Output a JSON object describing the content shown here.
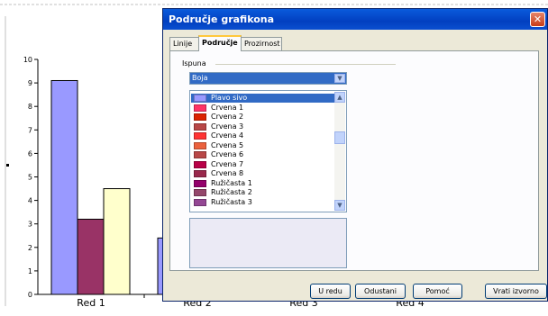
{
  "chart_data": {
    "type": "bar",
    "categories": [
      "Red 1",
      "Red 2",
      "Red 3",
      "Red 4"
    ],
    "series": [
      {
        "values": [
          9.1,
          2.4,
          null,
          null
        ],
        "color": "#9999ff"
      },
      {
        "values": [
          3.2,
          null,
          null,
          null
        ],
        "color": "#993366"
      },
      {
        "values": [
          4.5,
          null,
          null,
          null
        ],
        "color": "#ffffcc"
      }
    ],
    "ylim": [
      0,
      10
    ],
    "yticks": [
      "0",
      "1",
      "2",
      "3",
      "4",
      "5",
      "6",
      "7",
      "8",
      "9",
      "10"
    ]
  },
  "dialog": {
    "title": "Područje grafikona",
    "close_glyph": "✕",
    "tabs": [
      {
        "label": "Linije",
        "active": false
      },
      {
        "label": "Područje",
        "active": true
      },
      {
        "label": "Prozirnost",
        "active": false
      }
    ],
    "fill_group_label": "Ispuna",
    "fill_type": "Boja",
    "colors": [
      {
        "name": "Plavo sivo",
        "color": "#9999ff",
        "selected": true
      },
      {
        "name": "Crvena 1",
        "color": "#ff3366"
      },
      {
        "name": "Crvena 2",
        "color": "#dc2300"
      },
      {
        "name": "Crvena 3",
        "color": "#b84747"
      },
      {
        "name": "Crvena 4",
        "color": "#ff3333"
      },
      {
        "name": "Crvena 5",
        "color": "#eb613d"
      },
      {
        "name": "Crvena 6",
        "color": "#b84747"
      },
      {
        "name": "Crvena 7",
        "color": "#b80047"
      },
      {
        "name": "Crvena 8",
        "color": "#99284c"
      },
      {
        "name": "Ružičasta 1",
        "color": "#94006b"
      },
      {
        "name": "Ružičasta 2",
        "color": "#94476b"
      },
      {
        "name": "Ružičasta 3",
        "color": "#944794"
      }
    ],
    "buttons": {
      "ok": "U redu",
      "cancel": "Odustani",
      "help": "Pomoć",
      "reset": "Vrati izvorno"
    }
  }
}
